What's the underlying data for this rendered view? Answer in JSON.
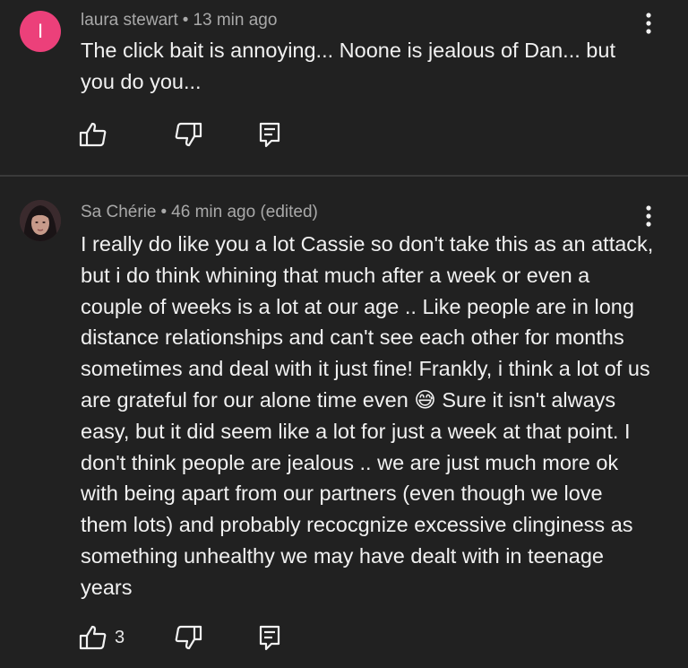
{
  "comments": [
    {
      "avatar_letter": "I",
      "avatar_color": "#ec407a",
      "author": "laura stewart",
      "separator": "•",
      "time": "13 min ago",
      "text": "The click bait is annoying... Noone is jealous of Dan... but you do you...",
      "like_count": ""
    },
    {
      "author": "Sa Chérie",
      "separator": "•",
      "time": "46 min ago (edited)",
      "text": "I really do like you a lot Cassie so don't take this as an attack, but i do think whining that much after a week or even a couple of weeks is a lot at our age .. Like people are in long distance relationships and can't see each other for months sometimes and deal with it just fine! Frankly, i think a lot of us are grateful for our alone time even 😅 Sure it isn't always easy, but it did seem like a lot for just a week at that point. I don't think people are jealous .. we are just much more ok with being apart from our partners (even though we love them lots) and probably recocgnize excessive clinginess as something unhealthy we may have dealt with in teenage years",
      "like_count": "3"
    }
  ],
  "icons": {
    "more": "more-vert-icon",
    "like": "thumbs-up-icon",
    "dislike": "thumbs-down-icon",
    "reply": "reply-icon"
  },
  "colors": {
    "background": "#212121",
    "text": "#f1f1f1",
    "meta": "#a9a9a9",
    "divider": "#3a3a3a"
  }
}
